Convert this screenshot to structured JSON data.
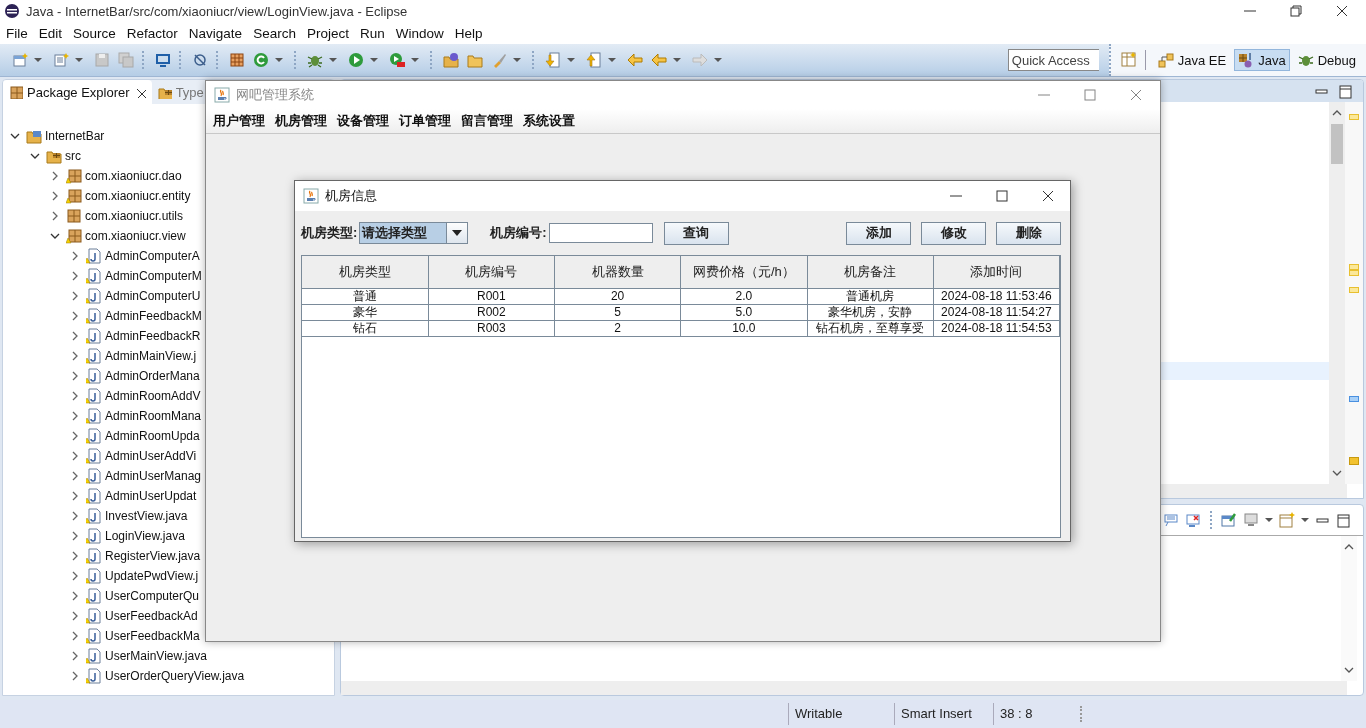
{
  "window": {
    "title": "Java - InternetBar/src/com/xiaoniucr/view/LoginView.java - Eclipse"
  },
  "menu": [
    "File",
    "Edit",
    "Source",
    "Refactor",
    "Navigate",
    "Search",
    "Project",
    "Run",
    "Window",
    "Help"
  ],
  "quick_access": {
    "placeholder": "Quick Access"
  },
  "perspectives": [
    {
      "label": "Java EE",
      "selected": false
    },
    {
      "label": "Java",
      "selected": true
    },
    {
      "label": "Debug",
      "selected": false
    }
  ],
  "left_panel": {
    "tabs": [
      {
        "label": "Package Explorer",
        "selected": true
      },
      {
        "label": "Type",
        "selected": false
      }
    ],
    "tree": [
      {
        "label": "InternetBar",
        "kind": "project",
        "expanded": true,
        "children": [
          {
            "label": "src",
            "kind": "folder",
            "expanded": true,
            "children": [
              {
                "label": "com.xiaoniucr.dao",
                "kind": "package",
                "expanded": false
              },
              {
                "label": "com.xiaoniucr.entity",
                "kind": "package",
                "expanded": false
              },
              {
                "label": "com.xiaoniucr.utils",
                "kind": "package",
                "expanded": false
              },
              {
                "label": "com.xiaoniucr.view",
                "kind": "package",
                "expanded": true,
                "children": [
                  {
                    "label": "AdminComputerA",
                    "kind": "file",
                    "expanded": false
                  },
                  {
                    "label": "AdminComputerM",
                    "kind": "file",
                    "expanded": false
                  },
                  {
                    "label": "AdminComputerU",
                    "kind": "file",
                    "expanded": false
                  },
                  {
                    "label": "AdminFeedbackM",
                    "kind": "file",
                    "expanded": false
                  },
                  {
                    "label": "AdminFeedbackR",
                    "kind": "file",
                    "expanded": false
                  },
                  {
                    "label": "AdminMainView.j",
                    "kind": "file",
                    "expanded": false
                  },
                  {
                    "label": "AdminOrderMana",
                    "kind": "file",
                    "expanded": false
                  },
                  {
                    "label": "AdminRoomAddV",
                    "kind": "file",
                    "expanded": false
                  },
                  {
                    "label": "AdminRoomMana",
                    "kind": "file",
                    "expanded": false
                  },
                  {
                    "label": "AdminRoomUpda",
                    "kind": "file",
                    "expanded": false
                  },
                  {
                    "label": "AdminUserAddVi",
                    "kind": "file",
                    "expanded": false
                  },
                  {
                    "label": "AdminUserManag",
                    "kind": "file",
                    "expanded": false
                  },
                  {
                    "label": "AdminUserUpdat",
                    "kind": "file",
                    "expanded": false
                  },
                  {
                    "label": "InvestView.java",
                    "kind": "file",
                    "expanded": false
                  },
                  {
                    "label": "LoginView.java",
                    "kind": "file",
                    "expanded": false
                  },
                  {
                    "label": "RegisterView.java",
                    "kind": "file",
                    "expanded": false
                  },
                  {
                    "label": "UpdatePwdView.j",
                    "kind": "file",
                    "expanded": false
                  },
                  {
                    "label": "UserComputerQu",
                    "kind": "file",
                    "expanded": false
                  },
                  {
                    "label": "UserFeedbackAd",
                    "kind": "file",
                    "expanded": false
                  },
                  {
                    "label": "UserFeedbackMa",
                    "kind": "file",
                    "expanded": false
                  },
                  {
                    "label": "UserMainView.java",
                    "kind": "file",
                    "expanded": false
                  },
                  {
                    "label": "UserOrderQueryView.java",
                    "kind": "file",
                    "expanded": false
                  }
                ]
              }
            ]
          }
        ]
      }
    ]
  },
  "status_bar": [
    "Writable",
    "Smart Insert",
    "38 : 8"
  ],
  "app_window": {
    "title": "网吧管理系统",
    "menu": [
      "用户管理",
      "机房管理",
      "设备管理",
      "订单管理",
      "留言管理",
      "系统设置"
    ]
  },
  "dialog": {
    "title": "机房信息",
    "type_filter": {
      "label": "机房类型:",
      "value": "请选择类型"
    },
    "number_filter": {
      "label": "机房编号:"
    },
    "search_button": "查询",
    "actions": [
      "添加",
      "修改",
      "删除"
    ],
    "table": {
      "columns": [
        "机房类型",
        "机房编号",
        "机器数量",
        "网费价格（元/h）",
        "机房备注",
        "添加时间"
      ],
      "rows": [
        [
          "普通",
          "R001",
          "20",
          "2.0",
          "普通机房",
          "2024-08-18 11:53:46"
        ],
        [
          "豪华",
          "R002",
          "5",
          "5.0",
          "豪华机房，安静",
          "2024-08-18 11:54:27"
        ],
        [
          "钻石",
          "R003",
          "2",
          "10.0",
          "钻石机房，至尊享受",
          "2024-08-18 11:54:53"
        ]
      ]
    }
  }
}
